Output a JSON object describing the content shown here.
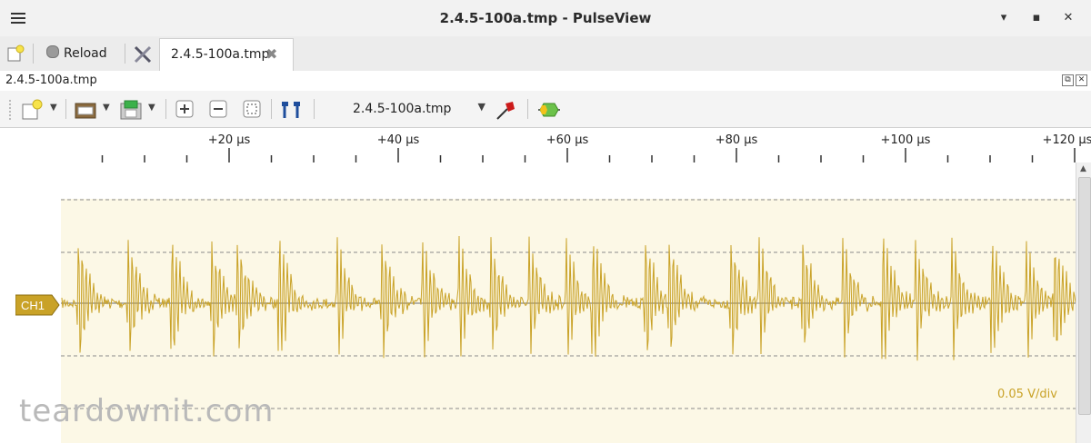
{
  "window": {
    "title": "2.4.5-100a.tmp - PulseView",
    "minimize": "▾",
    "maximize": "▪",
    "close": "✕"
  },
  "tabbar": {
    "reload_label": "Reload",
    "tab_label": "2.4.5-100a.tmp"
  },
  "docbar": {
    "title": "2.4.5-100a.tmp"
  },
  "toolbar": {
    "device_selected": "2.4.5-100a.tmp"
  },
  "ruler": {
    "labels": [
      "+20 µs",
      "+40 µs",
      "+60 µs",
      "+80 µs",
      "+100 µs",
      "+120 µs"
    ]
  },
  "channel": {
    "name": "CH1",
    "scale": "0.05 V/div",
    "color": "#c9a227"
  },
  "watermark": "teardownit.com",
  "chart_data": {
    "type": "line",
    "x_unit": "µs",
    "xlim": [
      0,
      122
    ],
    "x_ticks": [
      "+20 µs",
      "+40 µs",
      "+60 µs",
      "+80 µs",
      "+100 µs",
      "+120 µs"
    ],
    "y_scale": "0.05 V/div",
    "series": [
      {
        "name": "CH1",
        "pulse_times": [
          2.3,
          8.2,
          13.4,
          18.1,
          21.1,
          26.1,
          32.9,
          38.2,
          43.0,
          47.3,
          51.1,
          55.6,
          60.0,
          63.2,
          69.4,
          72.2,
          79.5,
          82.8,
          88.0,
          92.7,
          97.5,
          101.3,
          105.6,
          110.4,
          114.4,
          117.8
        ]
      }
    ]
  }
}
